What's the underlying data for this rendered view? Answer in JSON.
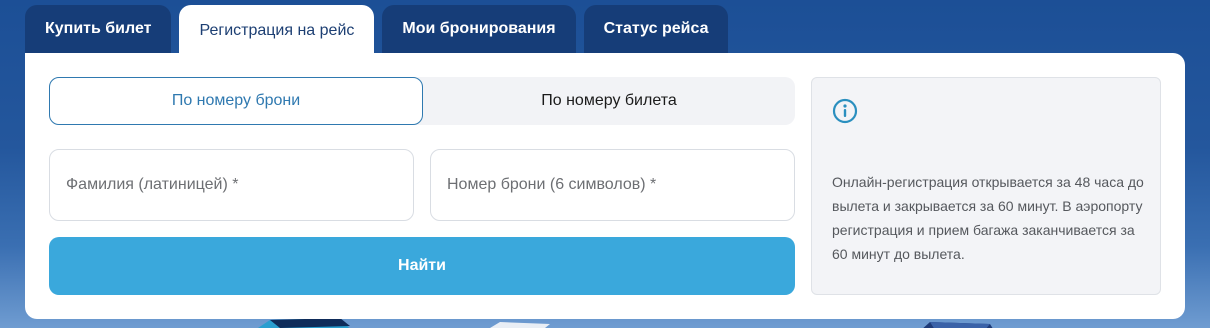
{
  "tabs": [
    {
      "label": "Купить билет",
      "active": false
    },
    {
      "label": "Регистрация на рейс",
      "active": true
    },
    {
      "label": "Мои бронирования",
      "active": false
    },
    {
      "label": "Статус рейса",
      "active": false
    }
  ],
  "search_mode": {
    "options": [
      "По номеру брони",
      "По номеру билета"
    ],
    "selected": "По номеру брони"
  },
  "form": {
    "surname_placeholder": "Фамилия (латиницей) *",
    "booking_placeholder": "Номер брони (6 символов) *",
    "submit_label": "Найти"
  },
  "info": {
    "icon": "info-icon",
    "text": "Онлайн-регистрация открывается за 48 часа до вылета и закрывается за 60 минут. В аэропорту регистрация и прием багажа заканчивается за 60 минут до вылета."
  },
  "colors": {
    "accent": "#3aa8dc",
    "tab_dark": "#163d78",
    "toggle_border": "#2f79b0"
  }
}
